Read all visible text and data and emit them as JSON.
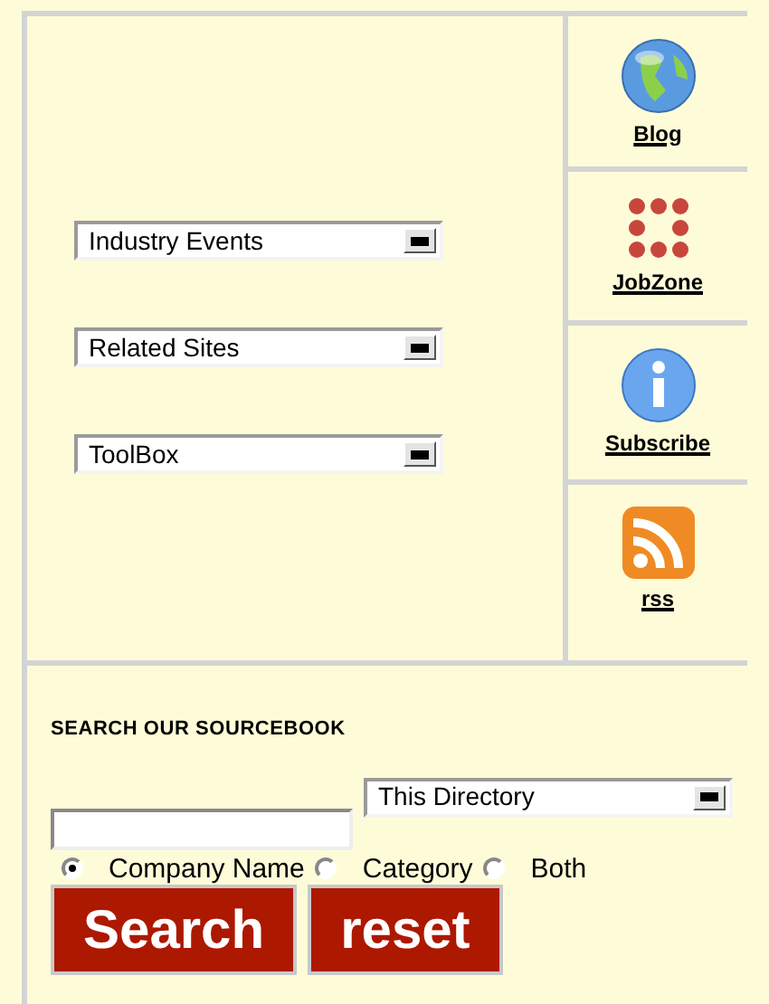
{
  "dropdowns": [
    {
      "value": "Industry Events"
    },
    {
      "value": "Related Sites"
    },
    {
      "value": "ToolBox"
    }
  ],
  "links": [
    {
      "label": "Blog",
      "kind": "globe"
    },
    {
      "label": "JobZone",
      "kind": "dots"
    },
    {
      "label": "Subscribe",
      "kind": "info"
    },
    {
      "label": "rss",
      "kind": "rss"
    }
  ],
  "search": {
    "heading": "SEARCH OUR SOURCEBOOK",
    "scope": "This Directory",
    "options": [
      {
        "label": "Company Name",
        "selected": true
      },
      {
        "label": "Category",
        "selected": false
      },
      {
        "label": "Both",
        "selected": false
      }
    ],
    "buttons": [
      "Search",
      "reset"
    ]
  }
}
